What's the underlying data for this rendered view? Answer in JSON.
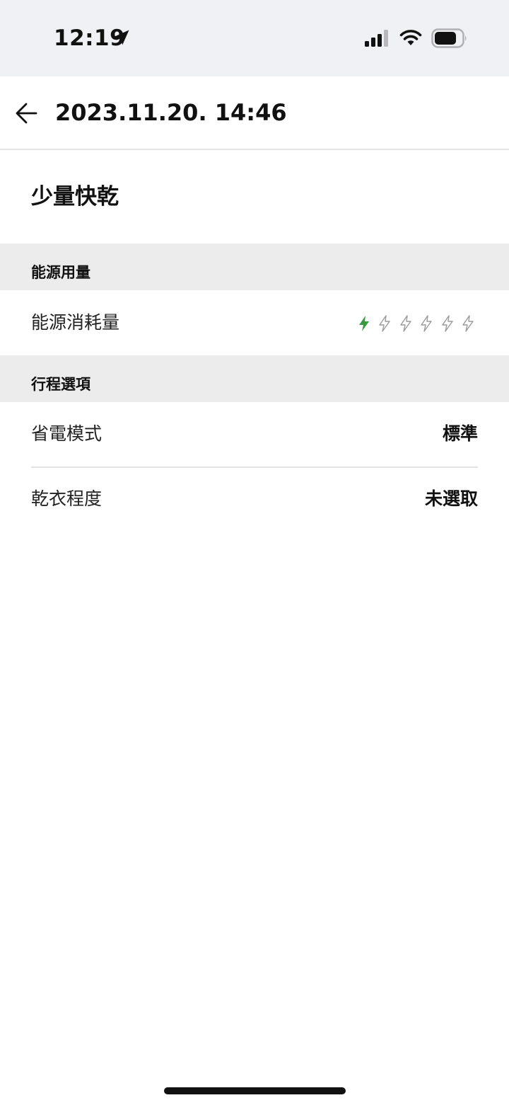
{
  "status_bar": {
    "time": "12:19",
    "icons": [
      "location-arrow-icon",
      "cellular-signal-icon",
      "wifi-icon",
      "battery-icon"
    ]
  },
  "header": {
    "back_icon": "arrow-left-icon",
    "title": "2023.11.20. 14:46"
  },
  "course": {
    "name": "少量快乾"
  },
  "energy_section": {
    "title": "能源用量",
    "row": {
      "label": "能源消耗量",
      "level": 1,
      "max_level": 6,
      "icon": "lightning-bolt-icon"
    }
  },
  "options_section": {
    "title": "行程選項",
    "rows": [
      {
        "label": "省電模式",
        "value": "標準"
      },
      {
        "label": "乾衣程度",
        "value": "未選取"
      }
    ]
  },
  "colors": {
    "status_bar_bg": "#f0f1f5",
    "section_bg": "#ececec",
    "active_bolt": "#3a9a3e",
    "inactive_bolt": "#9a9a9a",
    "text": "#111111"
  }
}
